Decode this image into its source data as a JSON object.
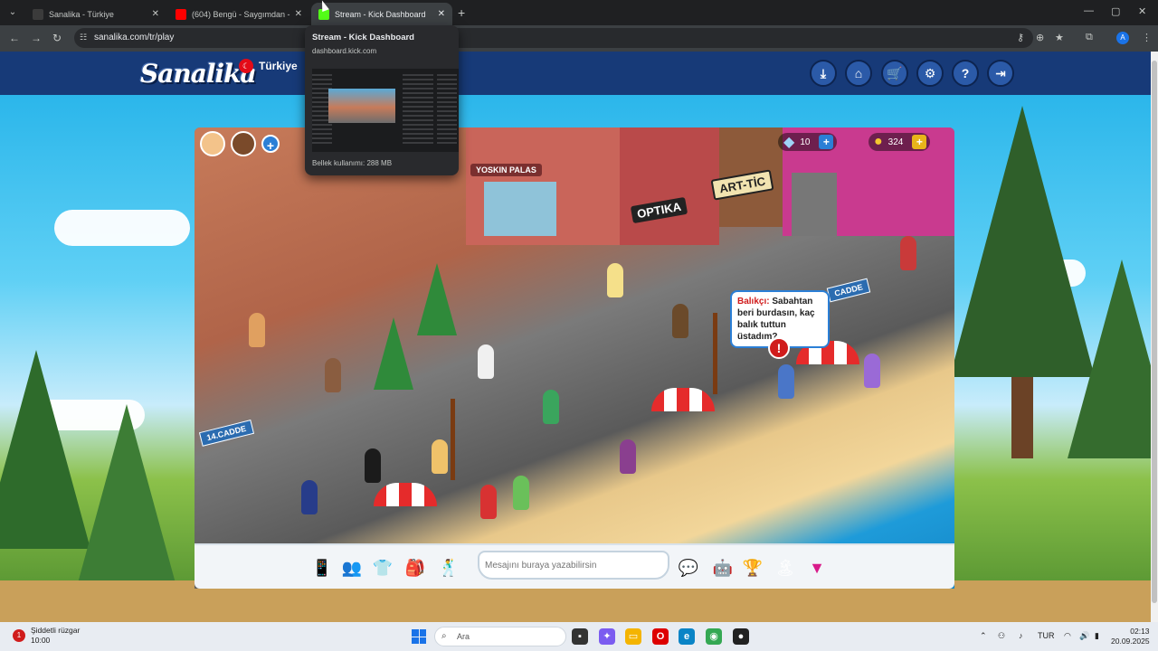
{
  "browser": {
    "tabs": [
      {
        "title": "Sanalika - Türkiye",
        "active": false,
        "favicon_color": "#3b3b3b"
      },
      {
        "title": "(604) Bengü - Saygımdan - You",
        "active": false,
        "favicon_color": "#ff0000"
      },
      {
        "title": "Stream - Kick Dashboard",
        "active": true,
        "favicon_color": "#53fc18"
      }
    ],
    "new_tab": "+",
    "url": "sanalika.com/tr/play",
    "window_controls": {
      "minimize": "—",
      "maximize": "▢",
      "close": "✕"
    },
    "nav": {
      "back": "←",
      "forward": "→",
      "reload": "↻"
    },
    "profile_initial": "A"
  },
  "tab_preview": {
    "title": "Stream - Kick Dashboard",
    "domain": "dashboard.kick.com",
    "memory": "Bellek kullanımı: 288 MB"
  },
  "site": {
    "logo": "Sanalika",
    "country": "Türkiye",
    "top_buttons": [
      {
        "name": "download-icon",
        "glyph": "⤓"
      },
      {
        "name": "home-icon",
        "glyph": "⌂"
      },
      {
        "name": "cart-icon",
        "glyph": "🛒"
      },
      {
        "name": "gear-icon",
        "glyph": "⚙"
      },
      {
        "name": "help-icon",
        "glyph": "?"
      },
      {
        "name": "logout-icon",
        "glyph": "⇥"
      }
    ]
  },
  "game": {
    "currency": {
      "diamonds": "10",
      "coins": "324"
    },
    "signs": {
      "optika": "OPTIKA",
      "art_tic": "ART-TİC",
      "yoskin": "YOSKIN PALAS",
      "cadde_left": "14.CADDE",
      "cadde_right": "CADDE"
    },
    "speech": {
      "speaker": "Balıkçı:",
      "text": "Sabahtan beri burdasın, kaç balık tuttun üstadım?"
    },
    "chat_placeholder": "Mesajını buraya yazabilirsin"
  },
  "taskbar": {
    "weather_title": "Şiddetli rüzgar",
    "weather_time": "10:00",
    "search_placeholder": "Ara",
    "language": "TUR",
    "time": "02:13",
    "date": "20.09.2025"
  },
  "colors": {
    "topbar": "#173a78",
    "kick_green": "#53fc18",
    "alert_red": "#d01c1c"
  }
}
